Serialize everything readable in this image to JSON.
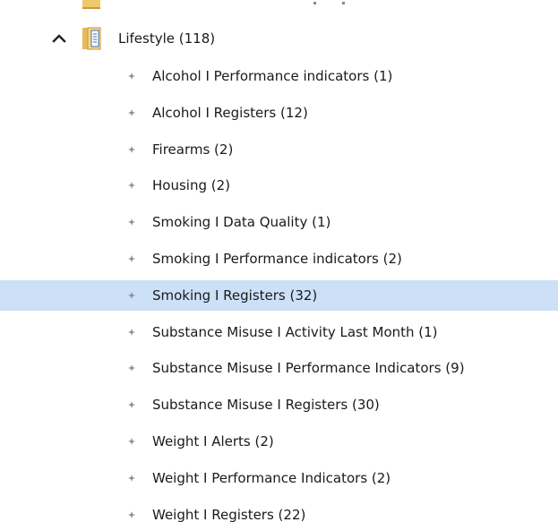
{
  "tree": {
    "parent": {
      "label": "Lifestyle (118)",
      "expanded": true,
      "icon": "chevron-up-icon"
    },
    "children": [
      {
        "label": "Alcohol I Performance indicators (1)",
        "selected": false
      },
      {
        "label": "Alcohol I Registers (12)",
        "selected": false
      },
      {
        "label": "Firearms (2)",
        "selected": false
      },
      {
        "label": "Housing (2)",
        "selected": false
      },
      {
        "label": "Smoking I Data Quality (1)",
        "selected": false
      },
      {
        "label": "Smoking I Performance indicators (2)",
        "selected": false
      },
      {
        "label": "Smoking I Registers (32)",
        "selected": true
      },
      {
        "label": "Substance Misuse I Activity Last Month (1)",
        "selected": false
      },
      {
        "label": "Substance Misuse I Performance Indicators (9)",
        "selected": false
      },
      {
        "label": "Substance Misuse I Registers (30)",
        "selected": false
      },
      {
        "label": "Weight I Alerts (2)",
        "selected": false
      },
      {
        "label": "Weight I Performance Indicators (2)",
        "selected": false
      },
      {
        "label": "Weight I Registers (22)",
        "selected": false
      }
    ]
  },
  "colors": {
    "selection": "#cce0f8",
    "folder": "#f0c96e",
    "bullet": "#8a8a8a",
    "text": "#1a1a1a"
  }
}
